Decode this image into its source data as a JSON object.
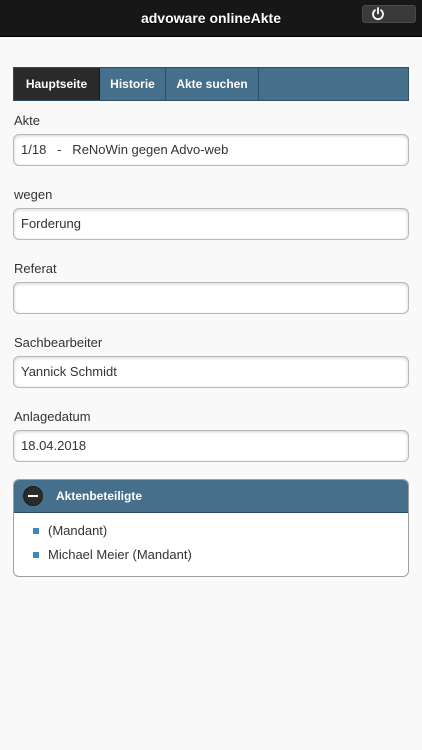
{
  "app": {
    "title": "advoware onlineAkte"
  },
  "nav": {
    "tabs": [
      {
        "label": "Hauptseite",
        "active": true
      },
      {
        "label": "Historie",
        "active": false
      },
      {
        "label": "Akte suchen",
        "active": false
      }
    ]
  },
  "form": {
    "akte": {
      "label": "Akte",
      "value": "1/18   -   ReNoWin gegen Advo-web"
    },
    "wegen": {
      "label": "wegen",
      "value": "Forderung"
    },
    "referat": {
      "label": "Referat",
      "value": ""
    },
    "sachbearbeiter": {
      "label": "Sachbearbeiter",
      "value": "Yannick Schmidt"
    },
    "anlagedatum": {
      "label": "Anlagedatum",
      "value": "18.04.2018"
    }
  },
  "aktenbeteiligte": {
    "title": "Aktenbeteiligte",
    "items": [
      "(Mandant)",
      "Michael Meier (Mandant)"
    ]
  },
  "icons": {
    "power": "power-icon",
    "collapse": "minus-icon"
  },
  "colors": {
    "header": "#171717",
    "accent": "#456f8a",
    "bullet": "#3c87c0"
  }
}
